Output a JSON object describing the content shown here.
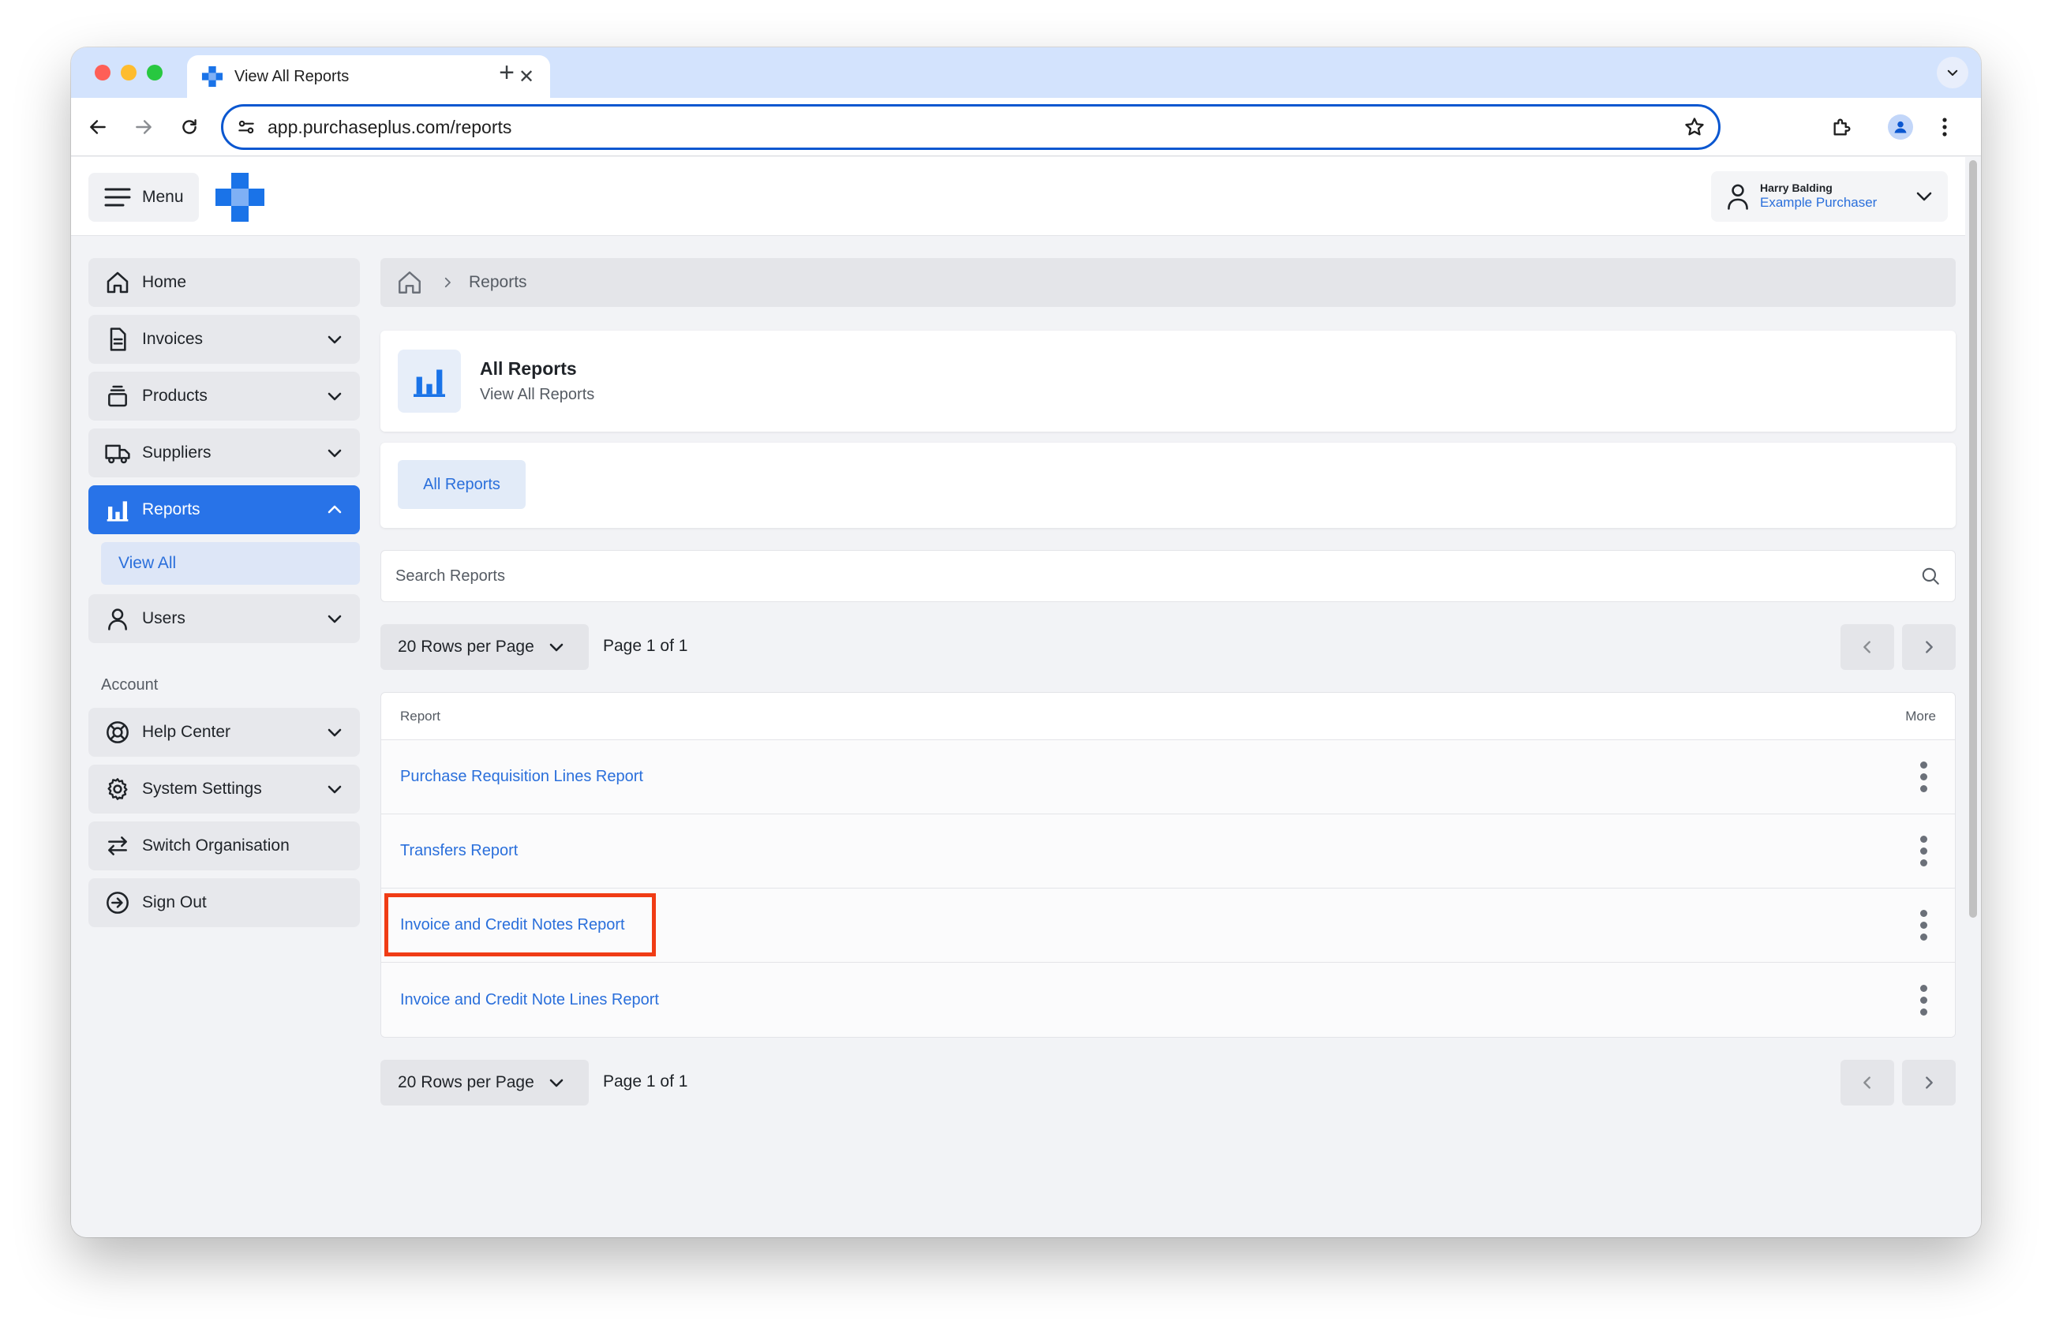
{
  "browser": {
    "tab_title": "View All Reports",
    "tab_close": "✕",
    "new_tab": "+",
    "url": "app.purchaseplus.com/reports"
  },
  "header": {
    "menu_label": "Menu",
    "user_name": "Harry Balding",
    "user_role": "Example Purchaser"
  },
  "sidebar": {
    "items": [
      {
        "label": "Home",
        "icon": "home-icon"
      },
      {
        "label": "Invoices",
        "icon": "invoice-icon"
      },
      {
        "label": "Products",
        "icon": "products-icon"
      },
      {
        "label": "Suppliers",
        "icon": "truck-icon"
      },
      {
        "label": "Reports",
        "icon": "bar-chart-icon"
      },
      {
        "label": "Users",
        "icon": "user-icon"
      }
    ],
    "reports_sub": "View All",
    "account_heading": "Account",
    "account_items": [
      {
        "label": "Help Center",
        "icon": "lifebuoy-icon"
      },
      {
        "label": "System Settings",
        "icon": "gear-icon"
      },
      {
        "label": "Switch Organisation",
        "icon": "switch-icon"
      },
      {
        "label": "Sign Out",
        "icon": "sign-out-icon"
      }
    ]
  },
  "breadcrumb": {
    "current": "Reports"
  },
  "page": {
    "title": "All Reports",
    "subtitle": "View All Reports",
    "tab": "All Reports"
  },
  "search": {
    "placeholder": "Search Reports"
  },
  "pagination": {
    "rows_per_page": "20 Rows per Page",
    "page_info": "Page 1 of 1"
  },
  "table": {
    "col_report": "Report",
    "col_more": "More",
    "rows": [
      "Purchase Requisition Lines Report",
      "Transfers Report",
      "Invoice and Credit Notes Report",
      "Invoice and Credit Note Lines Report"
    ],
    "highlighted_row": 2
  },
  "colors": {
    "accent": "#2873e8",
    "link": "#2a6fdb",
    "highlight": "#f03c15"
  }
}
